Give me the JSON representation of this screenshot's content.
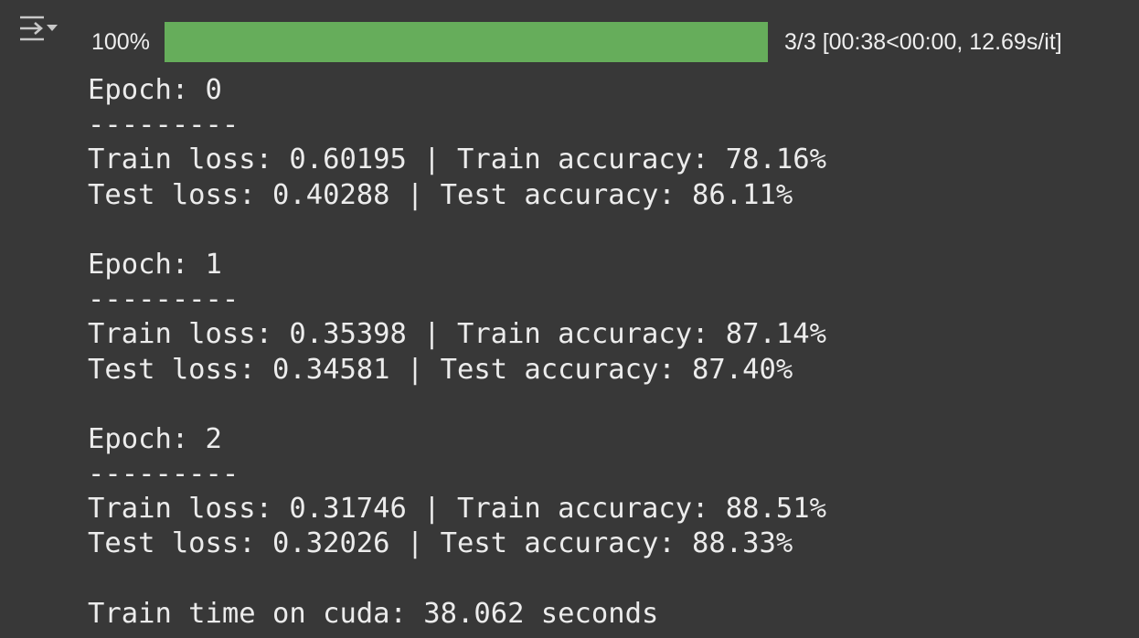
{
  "toolbar": {
    "toggle_icon": "output-collapse-icon"
  },
  "progress": {
    "percent_label": "100%",
    "fraction": 1.0,
    "status_text": "3/3 [00:38<00:00, 12.69s/it]",
    "fill_color": "#66ad5b"
  },
  "log": {
    "lines": [
      "Epoch: 0",
      "---------",
      "Train loss: 0.60195 | Train accuracy: 78.16%",
      "Test loss: 0.40288 | Test accuracy: 86.11%",
      "",
      "Epoch: 1",
      "---------",
      "Train loss: 0.35398 | Train accuracy: 87.14%",
      "Test loss: 0.34581 | Test accuracy: 87.40%",
      "",
      "Epoch: 2",
      "---------",
      "Train loss: 0.31746 | Train accuracy: 88.51%",
      "Test loss: 0.32026 | Test accuracy: 88.33%",
      "",
      "Train time on cuda: 38.062 seconds"
    ]
  }
}
